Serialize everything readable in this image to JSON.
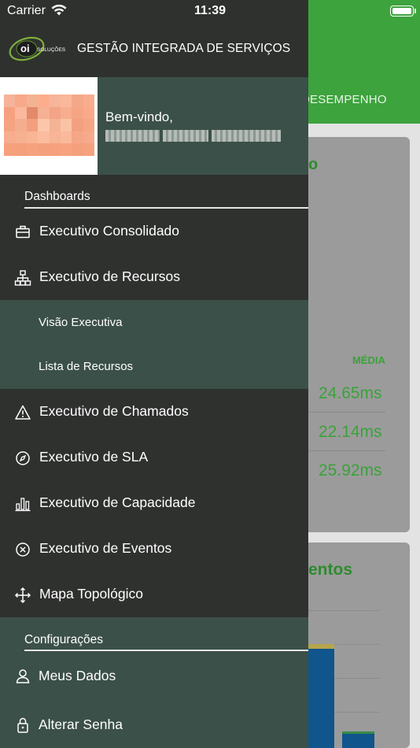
{
  "status_bar": {
    "carrier": "Carrier",
    "time": "11:39"
  },
  "app": {
    "title": "GESTÃO INTEGRADA DE SERVIÇOS",
    "logo_text": "oi",
    "logo_sub": "SOLUÇÕES"
  },
  "user": {
    "welcome": "Bem-vindo,"
  },
  "sections": {
    "dashboards": "Dashboards",
    "config": "Configurações"
  },
  "menu": [
    {
      "label": "Executivo Consolidado",
      "icon": "briefcase-icon"
    },
    {
      "label": "Executivo de Recursos",
      "icon": "hierarchy-icon"
    },
    {
      "label": "Executivo de Chamados",
      "icon": "warning-icon"
    },
    {
      "label": "Executivo de SLA",
      "icon": "compass-icon"
    },
    {
      "label": "Executivo de Capacidade",
      "icon": "bar-chart-icon"
    },
    {
      "label": "Executivo de Eventos",
      "icon": "close-circle-icon"
    },
    {
      "label": "Mapa Topológico",
      "icon": "move-arrows-icon"
    }
  ],
  "submenu": [
    {
      "label": "Visão Executiva"
    },
    {
      "label": "Lista de Recursos"
    }
  ],
  "config_menu": [
    {
      "label": "Meus Dados",
      "icon": "user-icon"
    },
    {
      "label": "Alterar Senha",
      "icon": "lock-icon"
    }
  ],
  "background": {
    "tab_label": "DESEMPENHO",
    "card1_title_fragment": "o",
    "column_label": "MÉDIA",
    "metrics": [
      "24.65ms",
      "22.14ms",
      "25.92ms"
    ],
    "card2_title_fragment": "entos"
  },
  "colors": {
    "brand_green": "#3da33d",
    "drawer_bg": "#2f312f",
    "drawer_accent": "#3b5048"
  }
}
